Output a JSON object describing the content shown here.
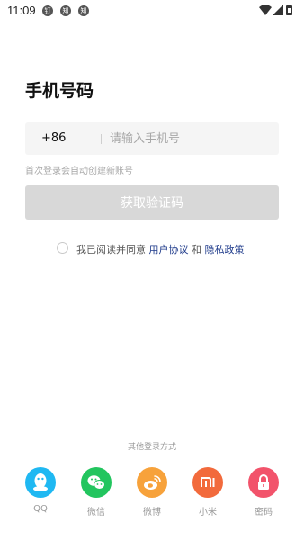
{
  "status_bar": {
    "time": "11:09",
    "notifications": [
      "钉",
      "知",
      "知"
    ]
  },
  "title": "手机号码",
  "phone": {
    "country_code": "+86",
    "placeholder": "请输入手机号",
    "value": ""
  },
  "hint": "首次登录会自动创建新账号",
  "get_code_button": "获取验证码",
  "agreement": {
    "prefix": "我已阅读并同意 ",
    "user_agreement": "用户协议",
    "and": " 和 ",
    "privacy_policy": "隐私政策",
    "checked": false
  },
  "other_login": {
    "label": "其他登录方式",
    "methods": [
      {
        "label": "QQ",
        "icon": "qq-icon",
        "color": "#1fb8f2"
      },
      {
        "label": "微信",
        "icon": "wechat-icon",
        "color": "#22c55e"
      },
      {
        "label": "微博",
        "icon": "weibo-icon",
        "color": "#f7a23b"
      },
      {
        "label": "小米",
        "icon": "xiaomi-icon",
        "color": "#f26a3c"
      },
      {
        "label": "密码",
        "icon": "lock-icon",
        "color": "#f2536b"
      }
    ]
  }
}
